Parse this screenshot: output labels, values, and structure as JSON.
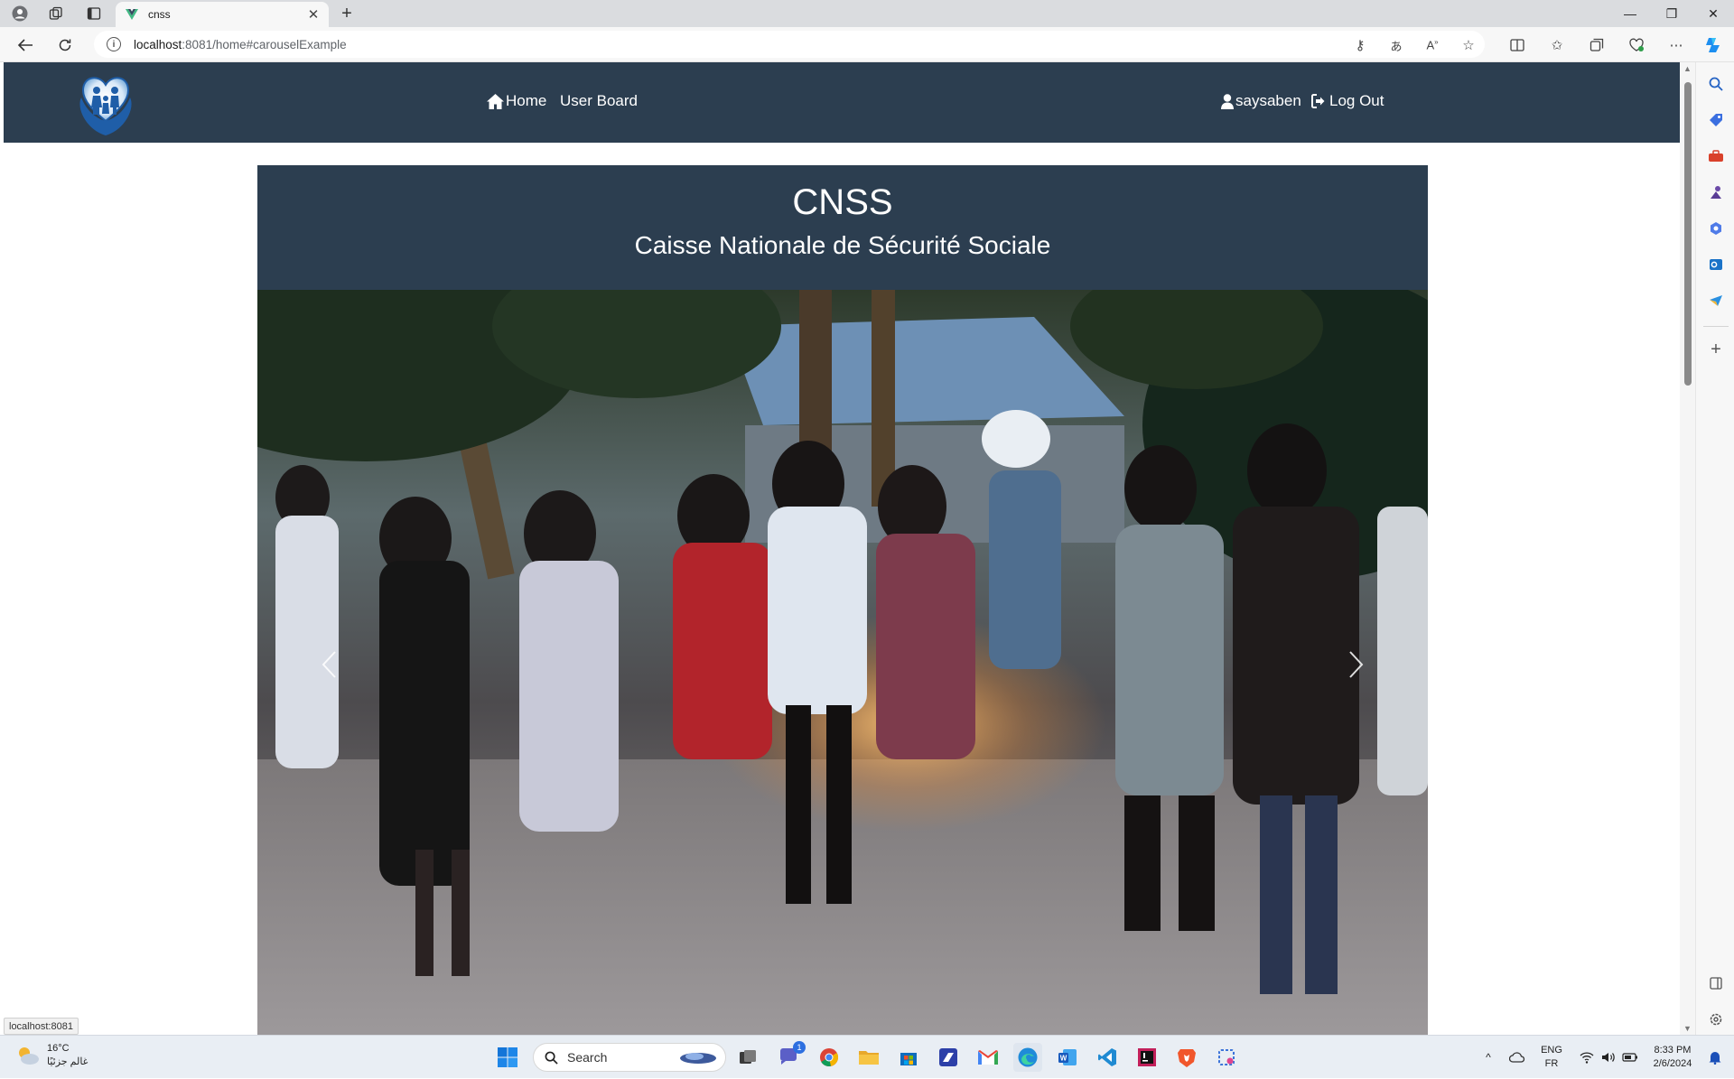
{
  "browser": {
    "tab": {
      "title": "cnss"
    },
    "address": {
      "host": "localhost",
      "rest": ":8081/home#carouselExample"
    },
    "status_tip": "localhost:8081"
  },
  "app": {
    "nav": {
      "home_label": "Home",
      "userboard_label": "User Board",
      "username_label": "saysaben",
      "logout_label": "Log Out"
    },
    "jumbotron": {
      "title": "CNSS",
      "subtitle": "Caisse Nationale de Sécurité Sociale"
    }
  },
  "taskbar": {
    "weather_temp": "16°C",
    "weather_desc": "غالم جزئيًا",
    "search_label": "Search",
    "lang_top": "ENG",
    "lang_bottom": "FR",
    "time": "8:33 PM",
    "date": "2/6/2024",
    "chat_badge": "1"
  },
  "colors": {
    "navbar": "#2c3e50",
    "edge_accent": "#0f7ae5"
  }
}
